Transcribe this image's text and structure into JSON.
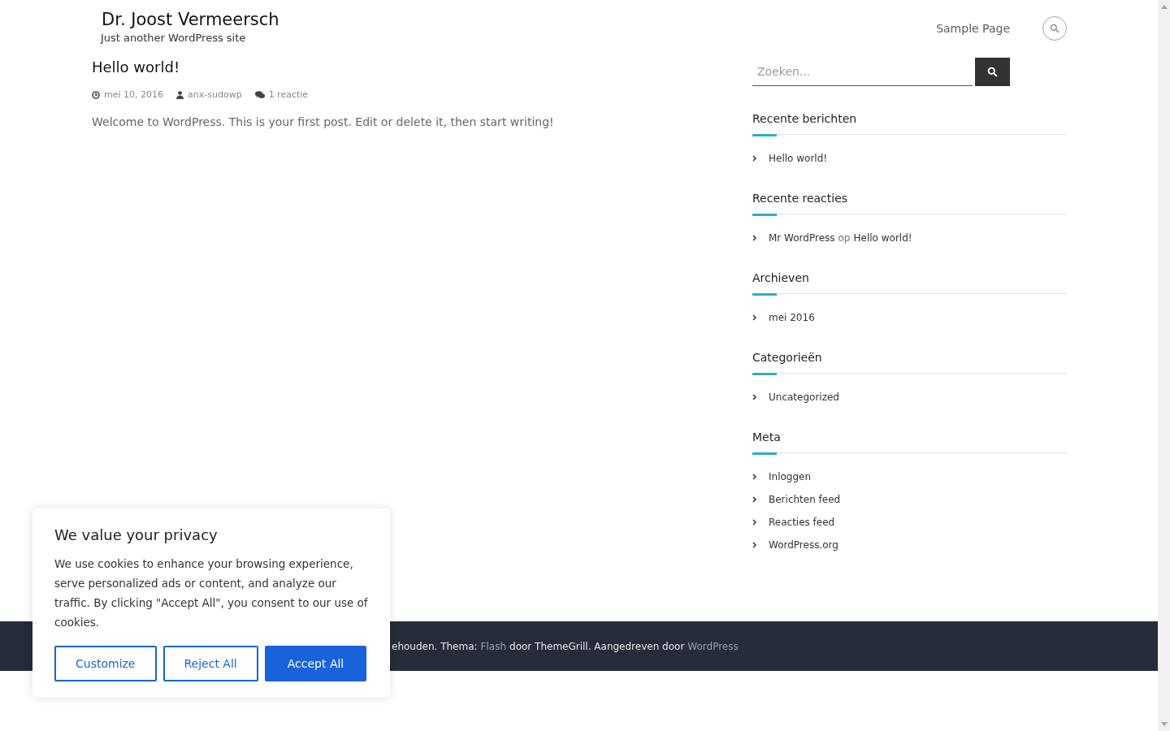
{
  "header": {
    "site_title": "Dr. Joost Vermeersch",
    "tagline": "Just another WordPress site",
    "nav": [
      "Sample Page"
    ]
  },
  "post": {
    "title": "Hello world!",
    "date": "mei 10, 2016",
    "author": "anx-sudowp",
    "comments": "1 reactie",
    "excerpt": "Welcome to WordPress. This is your first post. Edit or delete it, then start writing!"
  },
  "sidebar": {
    "search": {
      "placeholder": "Zoeken..."
    },
    "widgets": [
      {
        "title": "Recente berichten",
        "items": [
          {
            "kind": "link",
            "text": "Hello world!"
          }
        ]
      },
      {
        "title": "Recente reacties",
        "items": [
          {
            "kind": "comment",
            "author": "Mr WordPress",
            "joiner": "op",
            "post": "Hello world!"
          }
        ]
      },
      {
        "title": "Archieven",
        "items": [
          {
            "kind": "link",
            "text": "mei 2016"
          }
        ]
      },
      {
        "title": "Categorieën",
        "items": [
          {
            "kind": "link",
            "text": "Uncategorized"
          }
        ]
      },
      {
        "title": "Meta",
        "items": [
          {
            "kind": "link",
            "text": "Inloggen"
          },
          {
            "kind": "link",
            "text": "Berichten feed"
          },
          {
            "kind": "link",
            "text": "Reacties feed"
          },
          {
            "kind": "link",
            "text": "WordPress.org"
          }
        ]
      }
    ]
  },
  "footer": {
    "segments": [
      {
        "kind": "text",
        "text": "ehouden. Thema:"
      },
      {
        "kind": "link",
        "text": "Flash"
      },
      {
        "kind": "text",
        "text": "door ThemeGrill. Aangedreven door"
      },
      {
        "kind": "link",
        "text": "WordPress"
      }
    ]
  },
  "cookie_banner": {
    "title": "We value your privacy",
    "body": "We use cookies to enhance your browsing experience, serve personalized ads or content, and analyze our traffic. By clicking \"Accept All\", you consent to our use of cookies.",
    "buttons": [
      {
        "kind": "outline",
        "label": "Customize"
      },
      {
        "kind": "outline",
        "label": "Reject All"
      },
      {
        "kind": "primary",
        "label": "Accept All"
      }
    ]
  }
}
